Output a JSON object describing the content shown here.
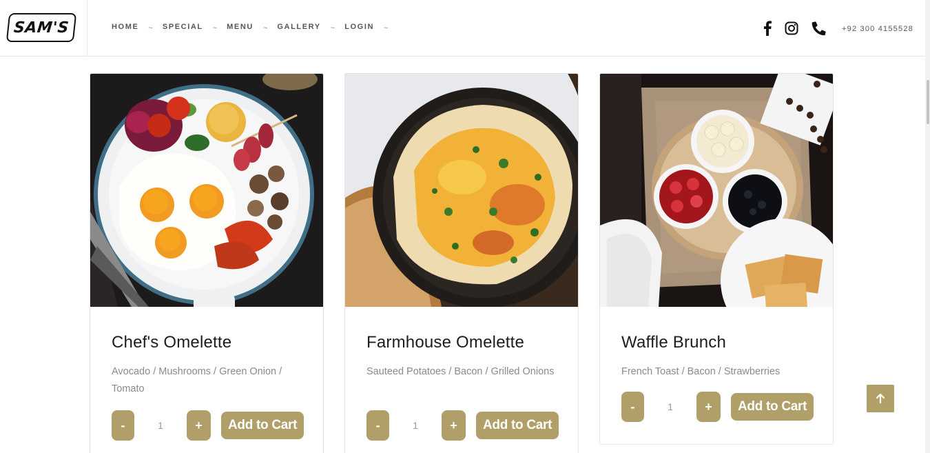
{
  "brand": {
    "logo_text": "SAM'S"
  },
  "nav": {
    "items": [
      {
        "label": "HOME",
        "caret": "~"
      },
      {
        "label": "SPECIAL",
        "caret": "~"
      },
      {
        "label": "MENU",
        "caret": "~"
      },
      {
        "label": "GALLERY",
        "caret": "~"
      },
      {
        "label": "LOGIN",
        "caret": "~"
      }
    ]
  },
  "contact": {
    "icons": [
      "facebook-icon",
      "instagram-icon",
      "phone-icon"
    ],
    "phone": "+92 300 4155528"
  },
  "theme": {
    "accent": "#b19f6a",
    "muted_text": "#8a8a8a"
  },
  "products": [
    {
      "title": "Chef's Omelette",
      "description": "Avocado / Mushrooms / Green Onion / Tomato",
      "qty": "1",
      "minus": "-",
      "plus": "+",
      "cart_label": "Add to Cart"
    },
    {
      "title": "Farmhouse Omelette",
      "description": "Sauteed Potatoes / Bacon / Grilled Onions",
      "qty": "1",
      "minus": "-",
      "plus": "+",
      "cart_label": "Add to Cart"
    },
    {
      "title": "Waffle Brunch",
      "description": "French Toast / Bacon / Strawberries",
      "qty": "1",
      "minus": "-",
      "plus": "+",
      "cart_label": "Add to Cart"
    }
  ],
  "back_to_top": {
    "icon": "arrow-up-icon"
  }
}
